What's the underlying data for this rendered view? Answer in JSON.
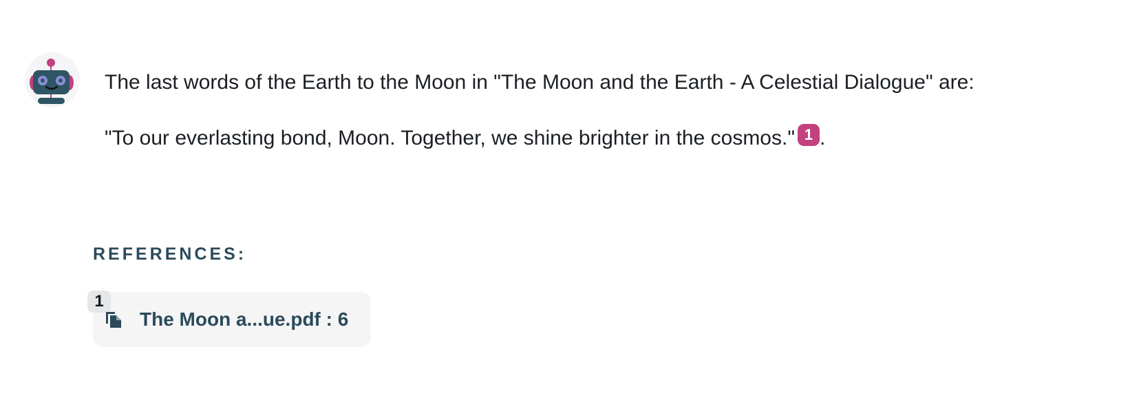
{
  "message": {
    "line1": "The last words of the Earth to the Moon in \"The Moon and the Earth - A Celestial Dialogue\" are:",
    "line2": "\"To our everlasting bond, Moon. Together, we shine brighter in the cosmos.\"",
    "citation": "1",
    "trailing": "."
  },
  "references": {
    "heading": "REFERENCES:",
    "items": [
      {
        "number": "1",
        "label": "The Moon a...ue.pdf : 6",
        "icon": "file-copy-icon"
      }
    ]
  },
  "avatar": {
    "icon": "robot-icon"
  },
  "colors": {
    "accent": "#c2417e",
    "heading": "#2b4a5a",
    "card_background": "#f5f5f6",
    "robot_face": "#2f5565",
    "robot_eye": "#8a8fd6"
  }
}
